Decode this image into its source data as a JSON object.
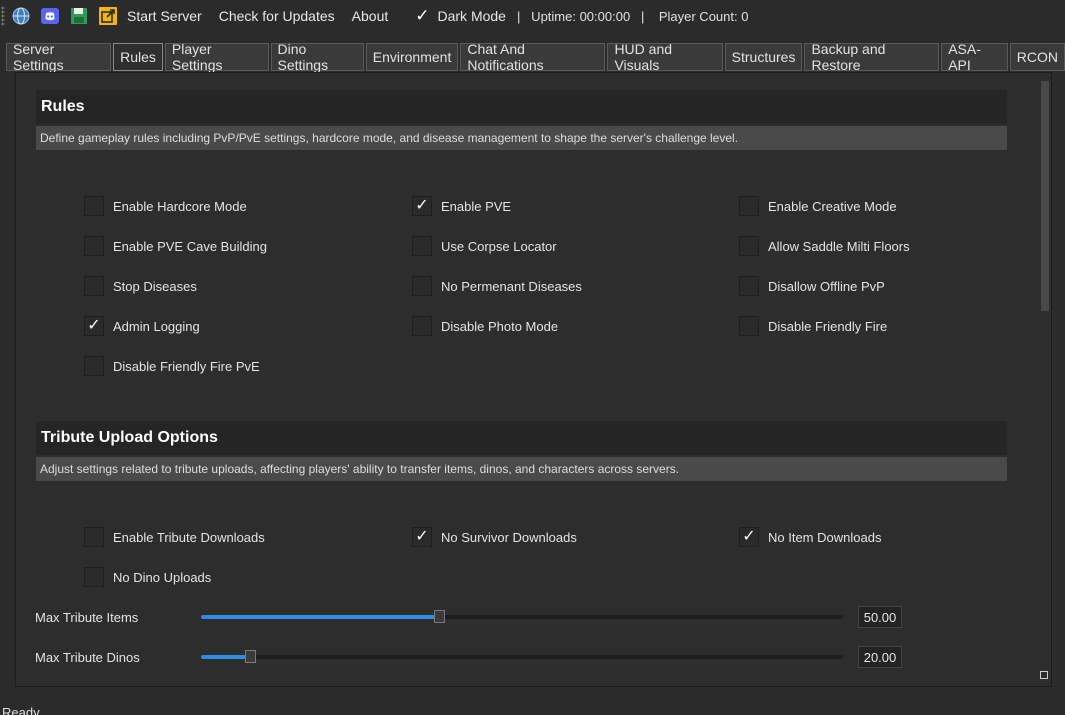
{
  "toolbar": {
    "icons": [
      "globe-icon",
      "discord-icon",
      "save-icon",
      "export-icon"
    ],
    "start_server": "Start Server",
    "check_updates": "Check for Updates",
    "about": "About",
    "dark_mode_label": "Dark Mode",
    "dark_mode_checked": true,
    "status": "|   Uptime: 00:00:00   |    Player Count: 0"
  },
  "tabs": [
    "Server Settings",
    "Rules",
    "Player Settings",
    "Dino Settings",
    "Environment",
    "Chat And Notifications",
    "HUD and Visuals",
    "Structures",
    "Backup and Restore",
    "ASA-API",
    "RCON"
  ],
  "active_tab": "Rules",
  "rules": {
    "title": "Rules",
    "description": "Define gameplay rules including PvP/PvE settings, hardcore mode, and disease management to shape the server's challenge level.",
    "options": [
      {
        "label": "Enable Hardcore Mode",
        "checked": false
      },
      {
        "label": "Enable PVE",
        "checked": true
      },
      {
        "label": "Enable Creative Mode",
        "checked": false
      },
      {
        "label": "Enable PVE Cave Building",
        "checked": false
      },
      {
        "label": "Use Corpse Locator",
        "checked": false
      },
      {
        "label": "Allow Saddle Milti Floors",
        "checked": false
      },
      {
        "label": "Stop Diseases",
        "checked": false
      },
      {
        "label": "No Permenant Diseases",
        "checked": false
      },
      {
        "label": "Disallow Offline PvP",
        "checked": false
      },
      {
        "label": "Admin Logging",
        "checked": true
      },
      {
        "label": "Disable Photo Mode",
        "checked": false
      },
      {
        "label": "Disable Friendly Fire",
        "checked": false
      },
      {
        "label": "Disable Friendly Fire PvE",
        "checked": false
      }
    ]
  },
  "tribute": {
    "title": "Tribute Upload Options",
    "description": "Adjust settings related to tribute uploads, affecting players' ability to transfer items, dinos, and characters across servers.",
    "options": [
      {
        "label": "Enable Tribute Downloads",
        "checked": false
      },
      {
        "label": "No Survivor Downloads",
        "checked": true
      },
      {
        "label": "No Item Downloads",
        "checked": true
      },
      {
        "label": "No Dino Uploads",
        "checked": false
      }
    ],
    "sliders": [
      {
        "label": "Max Tribute Items",
        "value": "50.00",
        "fraction": 0.37
      },
      {
        "label": "Max Tribute Dinos",
        "value": "20.00",
        "fraction": 0.077
      }
    ]
  },
  "status": "Ready"
}
